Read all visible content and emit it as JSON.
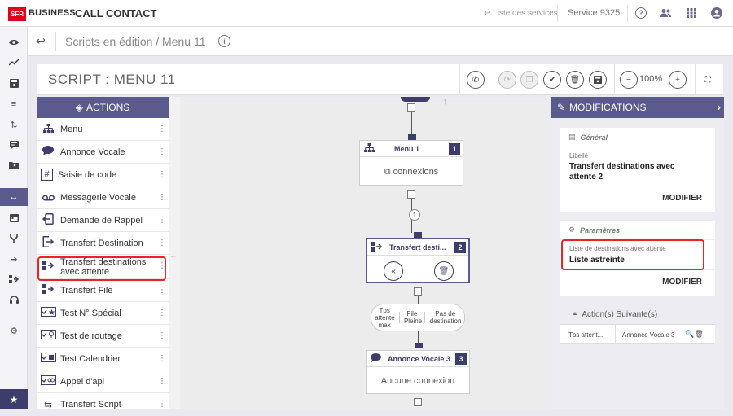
{
  "topbar": {
    "logo": "SFR",
    "brand": "BUSINESS",
    "app_title": "CALL CONTACT",
    "services_link": "↩ Liste des services",
    "service_number": "Service 9325"
  },
  "breadcrumb": {
    "text": "Scripts en édition / Menu 11"
  },
  "script": {
    "title": "SCRIPT : MENU 11",
    "zoom": "100%"
  },
  "actions": {
    "header": "ACTIONS",
    "items": [
      {
        "label": "Menu"
      },
      {
        "label": "Annonce Vocale"
      },
      {
        "label": "Saisie de code"
      },
      {
        "label": "Messagerie Vocale"
      },
      {
        "label": "Demande de Rappel"
      },
      {
        "label": "Transfert Destination"
      },
      {
        "label": "Transfert destinations avec attente"
      },
      {
        "label": "Transfert File"
      },
      {
        "label": "Test N° Spécial"
      },
      {
        "label": "Test de routage"
      },
      {
        "label": "Test Calendrier"
      },
      {
        "label": "Appel d'api"
      },
      {
        "label": "Transfert Script"
      }
    ]
  },
  "canvas": {
    "node_menu": {
      "title": "Menu 1",
      "num": "1",
      "body": "connexions"
    },
    "connector_label": "1",
    "node_transfert": {
      "title": "Transfert desti...",
      "num": "2"
    },
    "outputs": [
      "Tps attente max",
      "File Pleine",
      "Pas de destination"
    ],
    "node_annonce": {
      "title": "Annonce Vocale 3",
      "num": "3",
      "body": "Aucune connexion"
    }
  },
  "modifications": {
    "header": "MODIFICATIONS",
    "general": {
      "title": "Général",
      "field_label": "Libellé",
      "field_value": "Transfert destinations avec attente 2",
      "button": "MODIFIER"
    },
    "params": {
      "title": "Paramètres",
      "field_label": "Liste de destinations avec attente",
      "field_value": "Liste astreinte",
      "button": "MODIFIER"
    },
    "next": {
      "title": "Action(s) Suivante(s)",
      "col1": "Tps attent...",
      "col2": "Annonce Vocale 3"
    }
  }
}
